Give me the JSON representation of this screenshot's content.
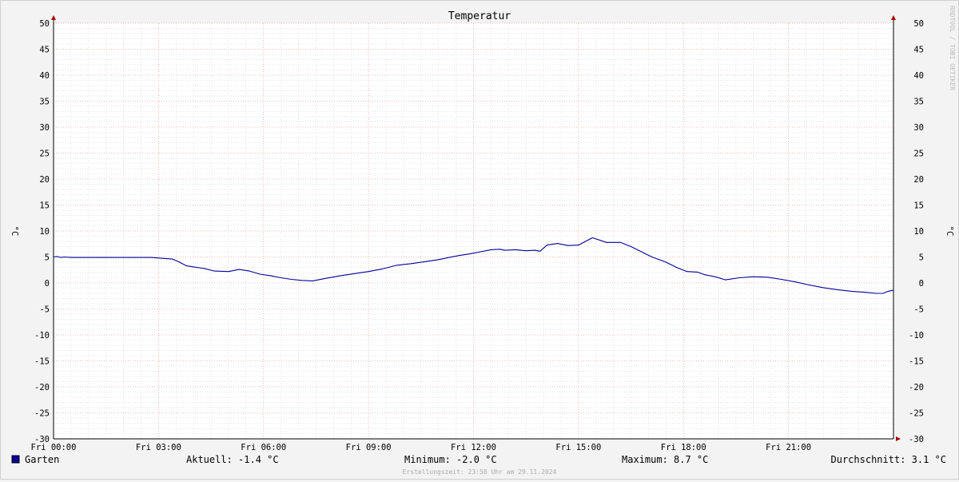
{
  "chart_data": {
    "type": "line",
    "title": "Temperatur",
    "ylabel": "°C",
    "ylim": [
      -30,
      50
    ],
    "y_major_step": 5,
    "y_minor_step": 1,
    "y_ticks": [
      "50",
      "45",
      "40",
      "35",
      "30",
      "25",
      "20",
      "15",
      "10",
      "5",
      "0",
      "-5",
      "-10",
      "-15",
      "-20",
      "-25",
      "-30"
    ],
    "x_ticks": [
      {
        "h": 0,
        "label": "Fri 00:00"
      },
      {
        "h": 3,
        "label": "Fri 03:00"
      },
      {
        "h": 6,
        "label": "Fri 06:00"
      },
      {
        "h": 9,
        "label": "Fri 09:00"
      },
      {
        "h": 12,
        "label": "Fri 12:00"
      },
      {
        "h": 15,
        "label": "Fri 15:00"
      },
      {
        "h": 18,
        "label": "Fri 18:00"
      },
      {
        "h": 21,
        "label": "Fri 21:00"
      }
    ],
    "xlim": [
      0,
      24
    ],
    "grid": true,
    "line_color": "#000099",
    "series": [
      {
        "name": "Garten",
        "x": [
          0,
          0.1,
          0.2,
          0.3,
          0.5,
          1,
          1.5,
          2,
          2.5,
          2.8,
          3.0,
          3.2,
          3.4,
          3.6,
          3.8,
          4.0,
          4.3,
          4.6,
          5.0,
          5.3,
          5.6,
          5.9,
          6.2,
          6.5,
          6.8,
          7.1,
          7.4,
          7.8,
          8.2,
          8.6,
          9.0,
          9.4,
          9.8,
          10.2,
          10.6,
          11.0,
          11.3,
          11.6,
          11.9,
          12.2,
          12.5,
          12.75,
          12.9,
          13.2,
          13.5,
          13.75,
          13.9,
          14.1,
          14.4,
          14.7,
          15.0,
          15.4,
          15.8,
          16.2,
          16.5,
          16.8,
          17.1,
          17.5,
          17.8,
          18.1,
          18.4,
          18.6,
          18.9,
          19.2,
          19.6,
          20.0,
          20.4,
          20.8,
          21.2,
          21.6,
          22.0,
          22.4,
          22.8,
          23.2,
          23.5,
          23.7,
          23.85,
          24.0
        ],
        "values": [
          5.0,
          5.1,
          4.9,
          5.0,
          4.9,
          4.9,
          4.9,
          4.9,
          4.9,
          4.9,
          4.8,
          4.7,
          4.6,
          4.0,
          3.3,
          3.1,
          2.8,
          2.3,
          2.2,
          2.6,
          2.3,
          1.7,
          1.4,
          1.0,
          0.7,
          0.5,
          0.4,
          0.9,
          1.4,
          1.8,
          2.2,
          2.7,
          3.4,
          3.7,
          4.1,
          4.5,
          4.9,
          5.3,
          5.6,
          6.0,
          6.4,
          6.5,
          6.3,
          6.4,
          6.2,
          6.3,
          6.1,
          7.3,
          7.6,
          7.2,
          7.3,
          8.7,
          7.8,
          7.8,
          7.0,
          6.0,
          5.0,
          4.0,
          3.0,
          2.2,
          2.1,
          1.6,
          1.2,
          0.6,
          1.0,
          1.2,
          1.1,
          0.7,
          0.2,
          -0.4,
          -0.9,
          -1.3,
          -1.6,
          -1.8,
          -2.0,
          -2.0,
          -1.6,
          -1.4
        ]
      }
    ]
  },
  "legend": {
    "swatch_color": "#000099",
    "series_label": "Garten",
    "current": "Aktuell: -1.4 °C",
    "minimum": "Minimum: -2.0 °C",
    "maximum": "Maximum: 8.7 °C",
    "average": "Durchschnitt: 3.1 °C"
  },
  "footer": "Erstellungszeit: 23:58 Uhr am 29.11.2024",
  "watermark": "RRDTOOL / TOBI OETIKER"
}
